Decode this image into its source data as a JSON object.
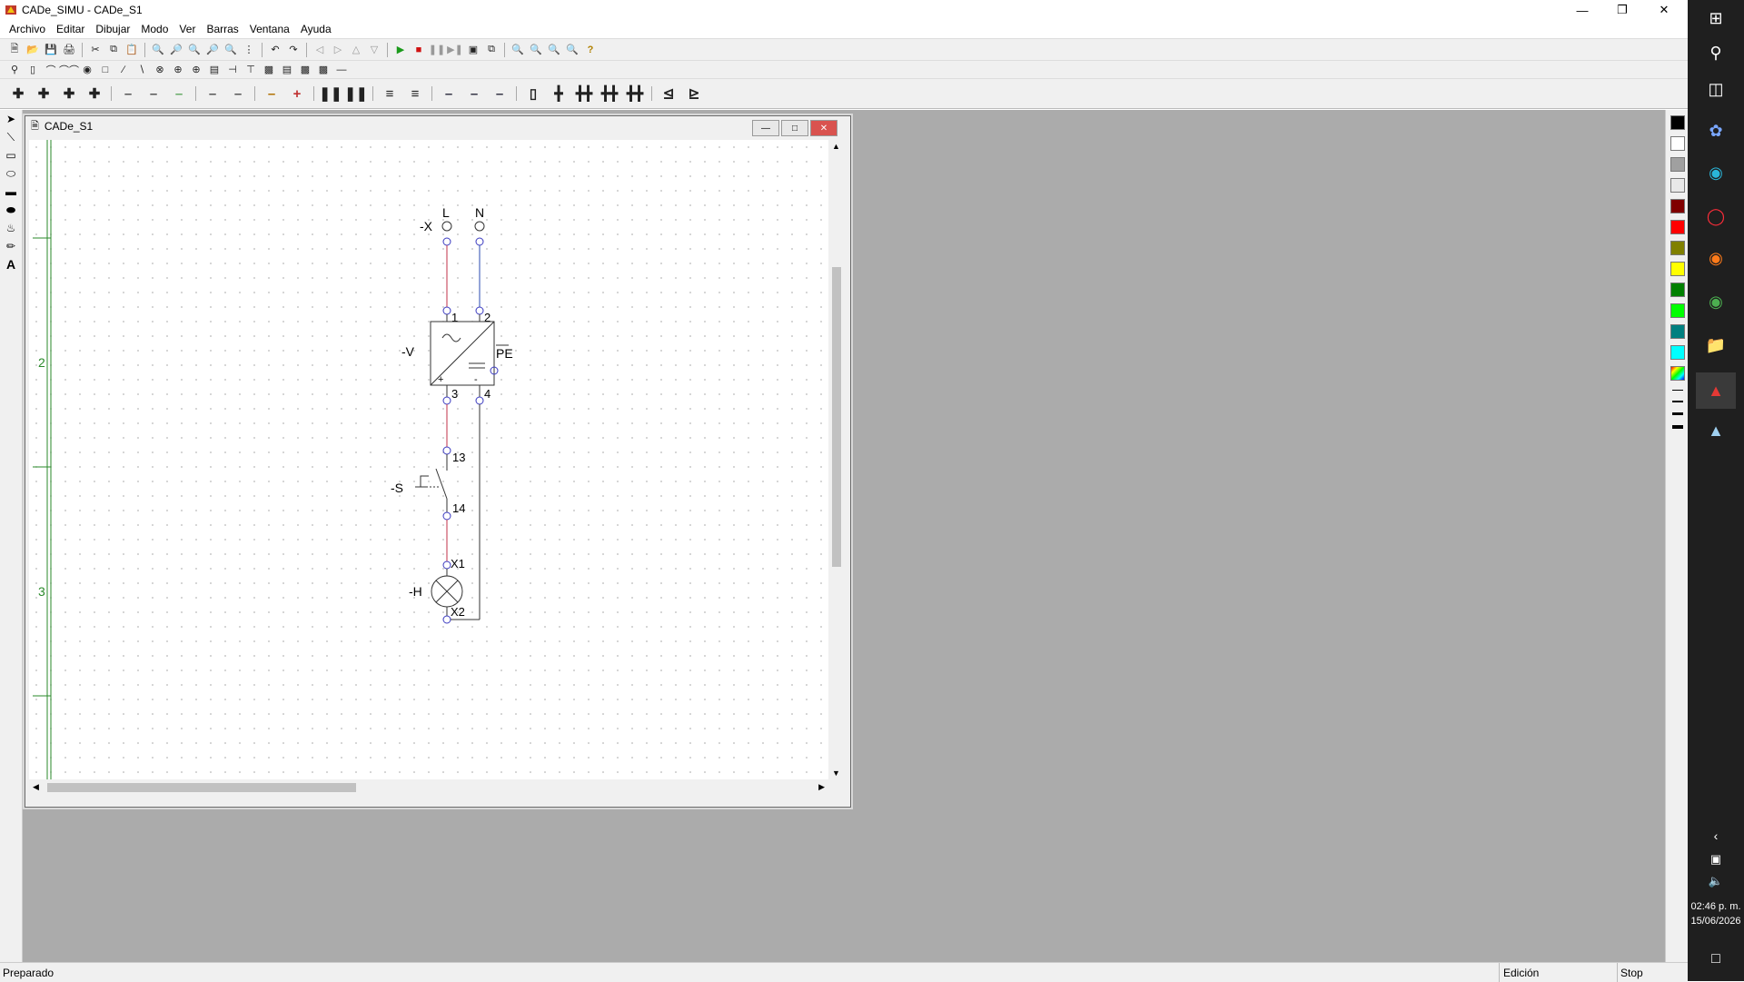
{
  "window": {
    "title": "CADe_SIMU - CADe_S1"
  },
  "menu": [
    "Archivo",
    "Editar",
    "Dibujar",
    "Modo",
    "Ver",
    "Barras",
    "Ventana",
    "Ayuda"
  ],
  "child": {
    "title": "CADe_S1"
  },
  "diagram": {
    "terminal_label": "-X",
    "phase_label": "L",
    "neutral_label": "N",
    "supply_label": "-V",
    "supply_pin1": "1",
    "supply_pin2": "2",
    "supply_pin3": "3",
    "supply_pin4": "4",
    "supply_pe": "PE",
    "supply_plus": "+",
    "supply_minus": "-",
    "switch_label": "-S",
    "switch_pin_top": "13",
    "switch_pin_bottom": "14",
    "lamp_label": "-H",
    "lamp_pin_top": "X1",
    "lamp_pin_bottom": "X2",
    "row_labels": [
      "2",
      "3"
    ],
    "colors": {
      "phase_wire": "#c0304a",
      "neutral_wire": "#2a4ab0",
      "grid_line": "#2a8a2a"
    }
  },
  "status": {
    "left": "Preparado",
    "mode": "Edición",
    "sim": "Stop"
  },
  "taskbar": {
    "time": "02:46 p. m.",
    "date": "15/06/2026"
  },
  "palette_colors": [
    "#000000",
    "#ffffff",
    "#a0a0a0",
    "#e8e8e8",
    "#800000",
    "#ff0000",
    "#808000",
    "#ffff00",
    "#008000",
    "#00ff00",
    "#008080",
    "#00ffff"
  ]
}
